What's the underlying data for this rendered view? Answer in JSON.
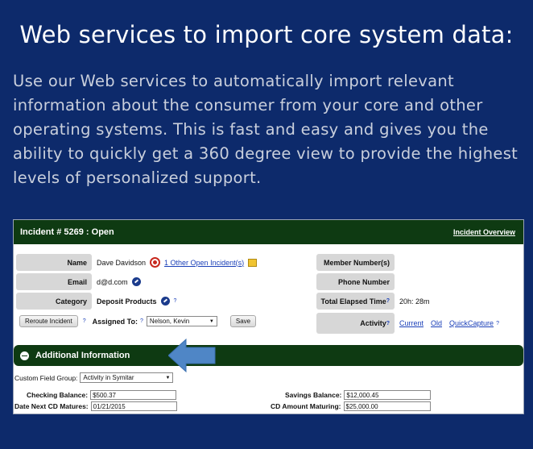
{
  "slide": {
    "title": "Web services to import core system data:",
    "body": "Use our Web services to automatically import relevant information about the consumer from your core and other operating systems.  This is fast and easy and gives you the ability to quickly get a 360 degree view to provide the highest levels of personalized support."
  },
  "incident": {
    "title": "Incident # 5269 : Open",
    "overview_link": "Incident Overview",
    "name_label": "Name",
    "name_value": "Dave Davidson",
    "open_incidents_link": "1 Other Open Incident(s)",
    "email_label": "Email",
    "email_value": "d@d.com",
    "category_label": "Category",
    "category_value": "Deposit Products",
    "help_mark": "?",
    "reroute_button": "Reroute Incident",
    "assigned_label": "Assigned To:",
    "assigned_value": "Nelson, Kevin",
    "save_button": "Save",
    "member_label": "Member Number(s)",
    "phone_label": "Phone Number",
    "elapsed_label": "Total Elapsed Time",
    "elapsed_value": "20h: 28m",
    "activity_label": "Activity",
    "activity_links": [
      "Current",
      "Old",
      "QuickCapture"
    ]
  },
  "additional": {
    "title": "Additional Information",
    "custom_group_label": "Custom Field Group:",
    "custom_group_value": "Activity in Symitar",
    "checking_label": "Checking Balance:",
    "checking_value": "$500.37",
    "savings_label": "Savings Balance:",
    "savings_value": "$12,000.45",
    "cd_date_label": "Date Next CD Matures:",
    "cd_date_value": "01/21/2015",
    "cd_amount_label": "CD Amount Maturing:",
    "cd_amount_value": "$25,000.00"
  },
  "colors": {
    "background": "#0d2a6b",
    "header_green": "#0e3a12",
    "arrow_blue": "#4f86c6"
  }
}
